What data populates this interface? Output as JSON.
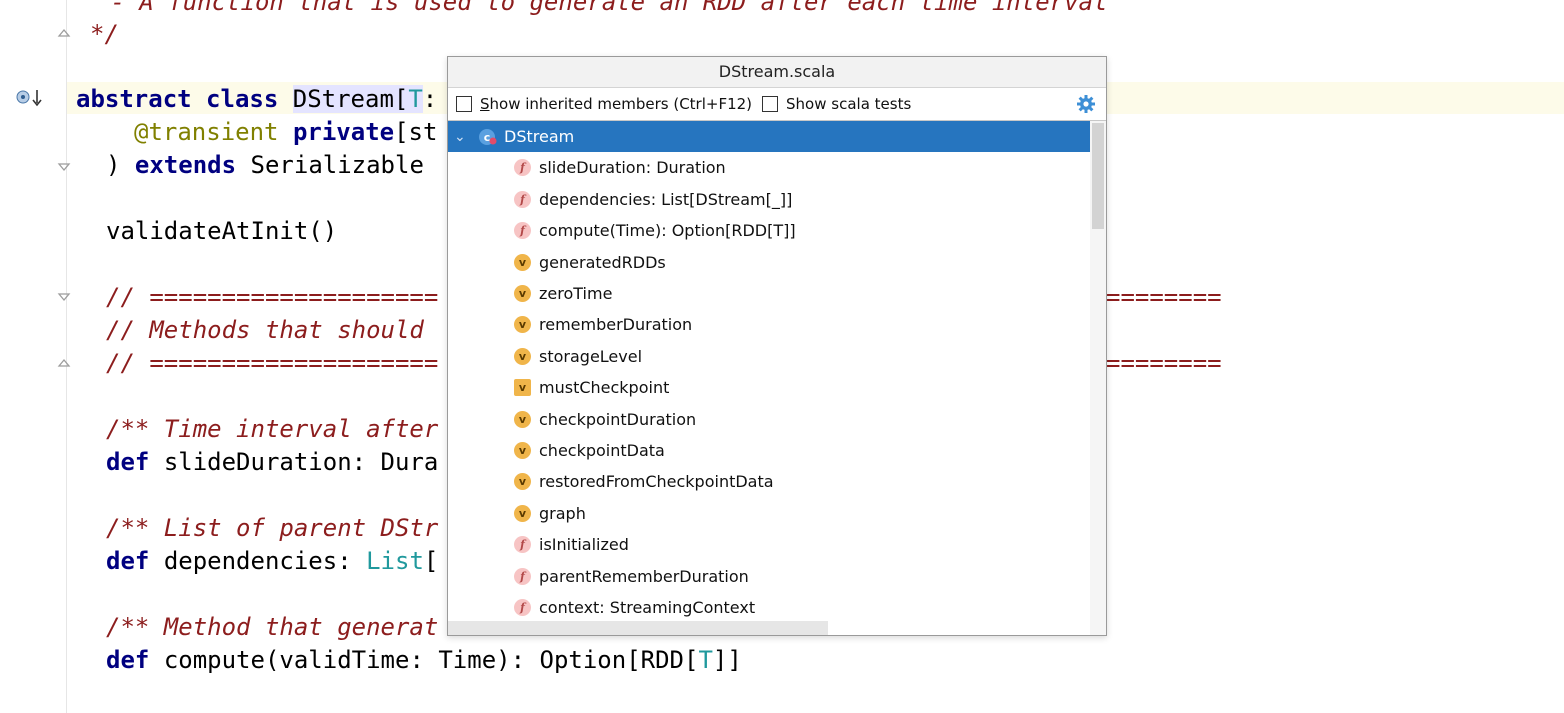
{
  "editor": {
    "lines": {
      "l1": " - A function that is used to generate an RDD after each time interval",
      "l2_star": "*/",
      "l3_kw1": "abstract",
      "l3_kw2": "class",
      "l3_name": "DStream[",
      "l3_tparam": "T",
      "l3_rest": ":",
      "l4_annot": "@transient",
      "l4_kw": "private",
      "l4_rest": "[st",
      "l5_paren": ")",
      "l5_kw": "extends",
      "l5_rest": "Serializable",
      "l6": "validateAtInit()",
      "l7": "// ====================",
      "l7b": "========",
      "l8": "// Methods that should",
      "l9": "// ====================",
      "l9b": "========",
      "l10": "/** Time interval after",
      "l11_kw": "def",
      "l11_rest": "slideDuration: Dura",
      "l12": "/** List of parent DStr",
      "l13_kw": "def",
      "l13_rest": "dependencies: ",
      "l13_type": "List",
      "l13_end": "[",
      "l14": "/** Method that generat",
      "l15_kw": "def",
      "l15_rest": "compute(validTime: Time): Option[RDD[",
      "l15_tparam": "T",
      "l15_end": "]]"
    }
  },
  "popup": {
    "title": "DStream.scala",
    "show_inherited_pre": "",
    "show_inherited_mnemonic": "S",
    "show_inherited_post": "how inherited members (Ctrl+F12)",
    "show_scala_tests": "Show scala tests",
    "root": {
      "label": "DStream",
      "icon": "class-icon"
    },
    "members": [
      {
        "badge": "f",
        "label": "slideDuration: Duration"
      },
      {
        "badge": "f",
        "label": "dependencies: List[DStream[_]]"
      },
      {
        "badge": "f",
        "label": "compute(Time): Option[RDD[T]]"
      },
      {
        "badge": "v",
        "label": "generatedRDDs"
      },
      {
        "badge": "v",
        "label": "zeroTime"
      },
      {
        "badge": "v",
        "label": "rememberDuration"
      },
      {
        "badge": "v",
        "label": "storageLevel"
      },
      {
        "badge": "v",
        "label": "mustCheckpoint"
      },
      {
        "badge": "v",
        "label": "checkpointDuration"
      },
      {
        "badge": "v",
        "label": "checkpointData"
      },
      {
        "badge": "v",
        "label": "restoredFromCheckpointData"
      },
      {
        "badge": "v",
        "label": "graph"
      },
      {
        "badge": "f",
        "label": "isInitialized"
      },
      {
        "badge": "f",
        "label": "parentRememberDuration"
      },
      {
        "badge": "f",
        "label": "context: StreamingContext"
      }
    ]
  },
  "colors": {
    "selection": "#2675bf",
    "keyword": "#000080",
    "comment": "#8c1d1d",
    "type_param": "#20999d"
  }
}
